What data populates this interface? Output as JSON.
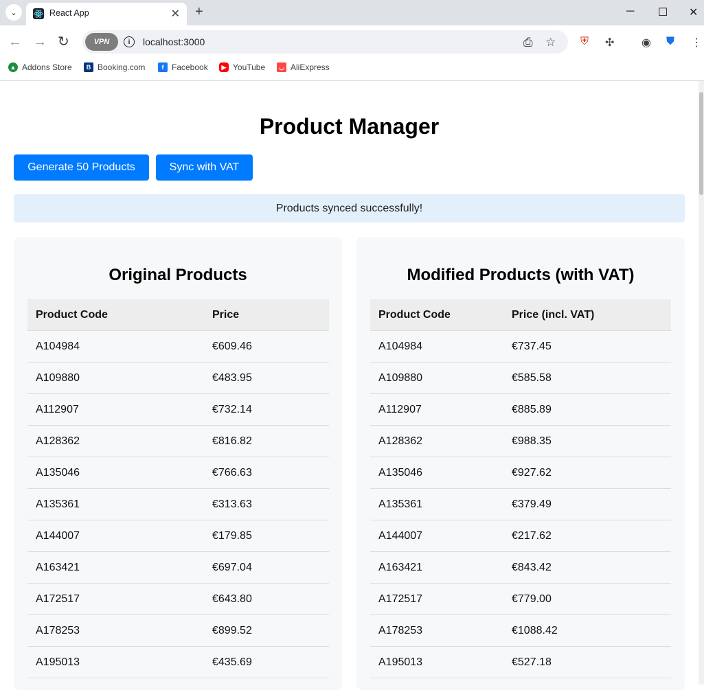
{
  "browser": {
    "tab_title": "React App",
    "url": "localhost:3000",
    "vpn_label": "VPN",
    "bookmarks": [
      {
        "label": "Addons Store",
        "icon": "addons-store-icon",
        "color": "#1e8e3e"
      },
      {
        "label": "Booking.com",
        "icon": "booking-icon",
        "color": "#003580"
      },
      {
        "label": "Facebook",
        "icon": "facebook-icon",
        "color": "#1877f2"
      },
      {
        "label": "YouTube",
        "icon": "youtube-icon",
        "color": "#ff0000"
      },
      {
        "label": "AliExpress",
        "icon": "aliexpress-icon",
        "color": "#ff4747"
      }
    ]
  },
  "page": {
    "title": "Product Manager",
    "buttons": {
      "generate": "Generate 50 Products",
      "sync": "Sync with VAT"
    },
    "status": "Products synced successfully!",
    "accent_color": "#007bff"
  },
  "original": {
    "heading": "Original Products",
    "columns": [
      "Product Code",
      "Price"
    ],
    "rows": [
      {
        "code": "A104984",
        "price": "€609.46"
      },
      {
        "code": "A109880",
        "price": "€483.95"
      },
      {
        "code": "A112907",
        "price": "€732.14"
      },
      {
        "code": "A128362",
        "price": "€816.82"
      },
      {
        "code": "A135046",
        "price": "€766.63"
      },
      {
        "code": "A135361",
        "price": "€313.63"
      },
      {
        "code": "A144007",
        "price": "€179.85"
      },
      {
        "code": "A163421",
        "price": "€697.04"
      },
      {
        "code": "A172517",
        "price": "€643.80"
      },
      {
        "code": "A178253",
        "price": "€899.52"
      },
      {
        "code": "A195013",
        "price": "€435.69"
      }
    ]
  },
  "modified": {
    "heading": "Modified Products (with VAT)",
    "columns": [
      "Product Code",
      "Price (incl. VAT)"
    ],
    "rows": [
      {
        "code": "A104984",
        "price": "€737.45"
      },
      {
        "code": "A109880",
        "price": "€585.58"
      },
      {
        "code": "A112907",
        "price": "€885.89"
      },
      {
        "code": "A128362",
        "price": "€988.35"
      },
      {
        "code": "A135046",
        "price": "€927.62"
      },
      {
        "code": "A135361",
        "price": "€379.49"
      },
      {
        "code": "A144007",
        "price": "€217.62"
      },
      {
        "code": "A163421",
        "price": "€843.42"
      },
      {
        "code": "A172517",
        "price": "€779.00"
      },
      {
        "code": "A178253",
        "price": "€1088.42"
      },
      {
        "code": "A195013",
        "price": "€527.18"
      }
    ]
  }
}
